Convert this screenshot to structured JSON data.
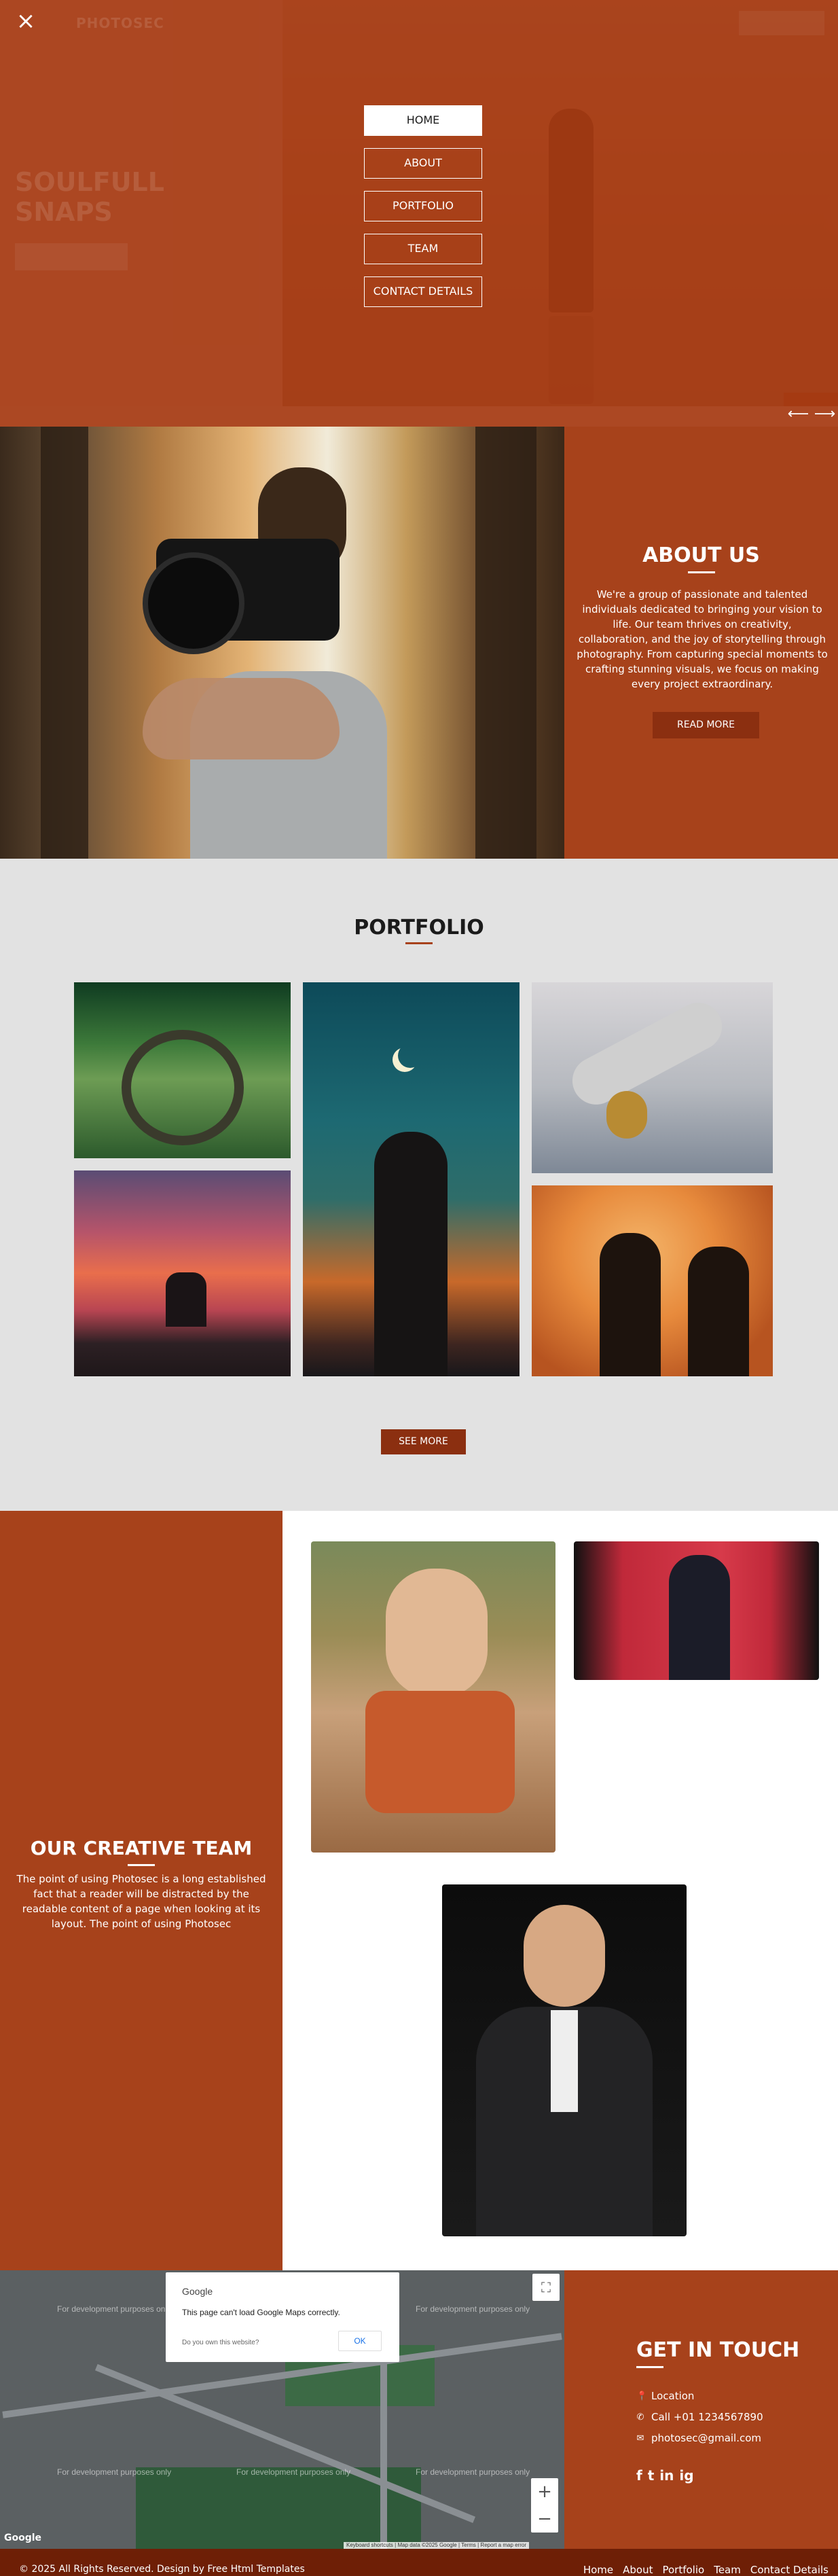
{
  "header": {
    "brand": "PHOTOSEC",
    "close_icon": "×",
    "hero_title": "SOULFULL\nSNAPS"
  },
  "menu": {
    "items": [
      "HOME",
      "ABOUT",
      "PORTFOLIO",
      "TEAM",
      "CONTACT DETAILS"
    ],
    "active_index": 0
  },
  "slider": {
    "prev_icon": "⟵",
    "next_icon": "⟶"
  },
  "about": {
    "title": "ABOUT US",
    "text": "We're a group of passionate and talented individuals dedicated to bringing your vision to life. Our team thrives on creativity, collaboration, and the joy of storytelling through photography. From capturing special moments to crafting stunning visuals, we focus on making every project extraordinary.",
    "button": "READ MORE"
  },
  "portfolio": {
    "title": "PORTFOLIO",
    "button": "SEE MORE"
  },
  "team": {
    "title": "OUR CREATIVE TEAM",
    "text": "The point of using Photosec is a long established fact that a reader will be distracted by the readable content of a page when looking at its layout. The point of using Photosec"
  },
  "map": {
    "google_logo": "Google",
    "error_message": "This page can't load Google Maps correctly.",
    "own_site_link": "Do you own this website?",
    "ok_button": "OK",
    "dev_watermark": "For development purposes only",
    "fullscreen_icon": "⛶",
    "zoom_in": "+",
    "zoom_out": "−",
    "attribution": "Keyboard shortcuts | Map data ©2025 Google | Terms | Report a map error",
    "brand_mark": "Google"
  },
  "contact": {
    "title": "GET IN TOUCH",
    "location": "Location",
    "phone": "Call +01 1234567890",
    "email": "photosec@gmail.com",
    "location_icon": "📍",
    "phone_icon": "✆",
    "email_icon": "✉",
    "social": [
      "f",
      "t",
      "in",
      "ig"
    ]
  },
  "footer": {
    "copyright": "© 2025 All Rights Reserved. Design by Free Html Templates",
    "nav": [
      "Home",
      "About",
      "Portfolio",
      "Team",
      "Contact Details"
    ]
  }
}
